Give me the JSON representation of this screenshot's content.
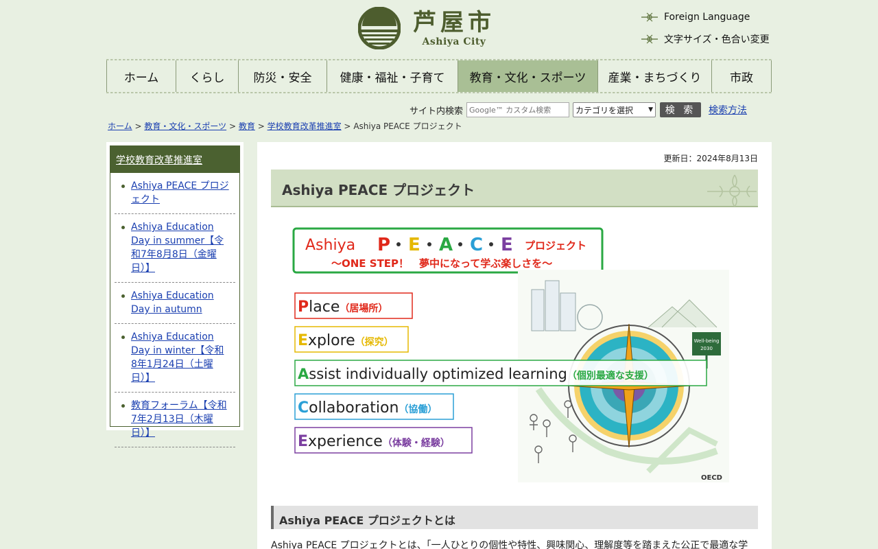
{
  "header": {
    "logo_jp": "芦屋市",
    "logo_en": "Ashiya City",
    "foreign_language": "Foreign Language",
    "text_size_color": "文字サイズ・色合い変更"
  },
  "gnav": [
    {
      "label": "ホーム",
      "active": false
    },
    {
      "label": "くらし",
      "active": false
    },
    {
      "label": "防災・安全",
      "active": false
    },
    {
      "label": "健康・福祉・子育て",
      "active": false
    },
    {
      "label": "教育・文化・スポーツ",
      "active": true
    },
    {
      "label": "産業・まちづくり",
      "active": false
    },
    {
      "label": "市政",
      "active": false
    }
  ],
  "search": {
    "label": "サイト内検索",
    "placeholder": "Google™ カスタム検索",
    "category_selected": "カテゴリを選択",
    "button": "検 索",
    "help_link": "検索方法"
  },
  "breadcrumb": {
    "items": [
      "ホーム",
      "教育・文化・スポーツ",
      "教育",
      "学校教育改革推進室"
    ],
    "separator": ">",
    "current": "Ashiya PEACE プロジェクト"
  },
  "sidebar": {
    "title": "学校教育改革推進室",
    "items": [
      "Ashiya PEACE プロジェクト",
      "Ashiya Education Day in summer【令和7年8月8日（金曜日）】",
      "Ashiya Education Day in autumn",
      "Ashiya Education Day in winter【令和8年1月24日（土曜日）】",
      "教育フォーラム【令和7年2月13日（木曜日）】"
    ]
  },
  "main": {
    "updated": "更新日：2024年8月13日",
    "page_title": "Ashiya PEACE プロジェクト",
    "figure": {
      "title_prefix": "Ashiya",
      "title_letters": [
        "P",
        "E",
        "A",
        "C",
        "E"
      ],
      "title_letter_colors": [
        "#e0281a",
        "#e5b800",
        "#2aa843",
        "#2a9fd6",
        "#7b3fa0"
      ],
      "title_suffix": "プロジェクト",
      "subtitle": "～ONE STEP！　夢中になって学ぶ楽しさを～",
      "items": [
        {
          "letter": "P",
          "rest": "lace",
          "jp": "（居場所）",
          "color": "#e0281a"
        },
        {
          "letter": "E",
          "rest": "xplore",
          "jp": "（探究）",
          "color": "#e5b800"
        },
        {
          "letter": "A",
          "rest": "ssist individually optimized learning",
          "jp": "（個別最適な支援）",
          "color": "#2aa843"
        },
        {
          "letter": "C",
          "rest": "ollaboration",
          "jp": "（協働）",
          "color": "#2a9fd6"
        },
        {
          "letter": "E",
          "rest": "xperience",
          "jp": "（体験・経験）",
          "color": "#7b3fa0"
        }
      ],
      "wellbeing": [
        "Well-being",
        "2030"
      ],
      "oecd": "OECD"
    },
    "section_title": "Ashiya PEACE プロジェクトとは",
    "body_text": "Ashiya PEACE プロジェクトとは、「一人ひとりの個性や特性、興味関心、理解度等を踏まえた公正で最適な学"
  }
}
